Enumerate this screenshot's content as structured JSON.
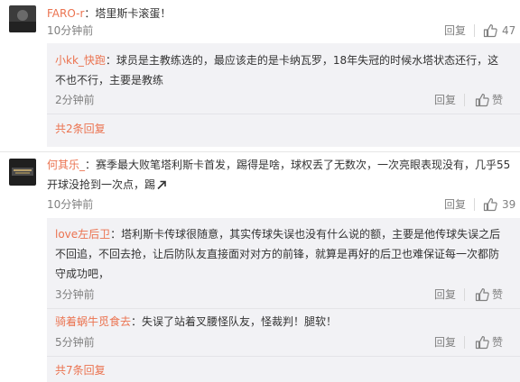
{
  "comments": [
    {
      "user": "FARO-r",
      "text": "：塔里斯卡滚蛋！",
      "time": "10分钟前",
      "reply_label": "回复",
      "like_count": "47",
      "replies": [
        {
          "user": "小kk_快跑",
          "text_line1": "：球员是主教练选的，最应该走的是卡纳瓦罗，18年失冠的时候水塔状态还行，这",
          "text_line2": "不也不行，主要是教练",
          "time": "2分钟前",
          "reply_label": "回复",
          "like_label": "赞"
        }
      ],
      "more_replies": "共2条回复"
    },
    {
      "user": "何其乐_",
      "text_line1": "：赛季最大败笔塔利斯卡首发，踢得是啥，球权丢了无数次，一次亮眼表现没有，几乎55",
      "text_line2": "开球没抢到一次点，踢",
      "time": "10分钟前",
      "reply_label": "回复",
      "like_count": "39",
      "replies": [
        {
          "user": "love左后卫",
          "text_line1": "：塔利斯卡传球很随意，其实传球失误也没有什么说的额，主要是他传球失误之后",
          "text_line2": "不回追，不回去抢，让后防队友直接面对对方的前锋，就算是再好的后卫也难保证每一次都防",
          "text_line3": "守成功吧，",
          "time": "3分钟前",
          "reply_label": "回复",
          "like_label": "赞"
        },
        {
          "user": "骑着蜗牛觅食去",
          "text": "：失误了站着叉腰怪队友，怪裁判！腿软！",
          "time": "5分钟前",
          "reply_label": "回复",
          "like_label": "赞"
        }
      ],
      "more_replies": "共7条回复"
    }
  ],
  "icons": {
    "like": "thumbs-up-icon",
    "expand": "arrow-up-right-icon"
  },
  "colors": {
    "username": "#eb7350",
    "meta": "#808080",
    "reply_bg": "#f2f2f5"
  }
}
